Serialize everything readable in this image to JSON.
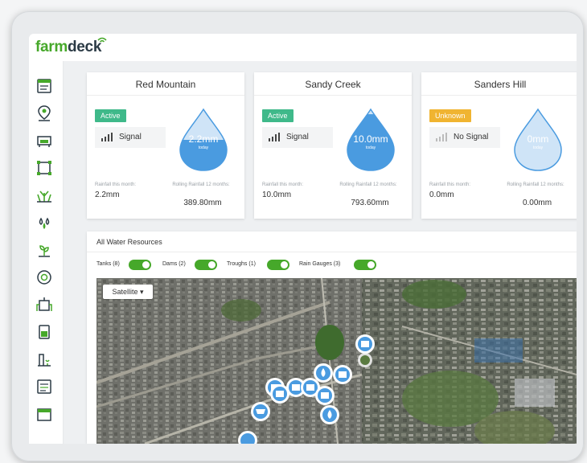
{
  "app": {
    "logo_part1": "farm",
    "logo_part2": "deck"
  },
  "sidebar": {
    "icons": [
      "dashboard-icon",
      "location-pin-icon",
      "livestock-icon",
      "paddock-map-icon",
      "crops-icon",
      "water-drops-icon",
      "seedling-icon",
      "gauge-icon",
      "pump-icon",
      "tank-icon",
      "irrigation-icon",
      "reports-icon",
      "calendar-icon"
    ]
  },
  "stations": [
    {
      "name": "Red Mountain",
      "status": "Active",
      "signal": "Signal",
      "amount": "2.2mm",
      "today": "today",
      "fill": 0.5,
      "month_label": "Rainfall this month:",
      "month_value": "2.2mm",
      "rolling_label": "Rolling Rainfall 12 months:",
      "rolling_value": "389.80mm"
    },
    {
      "name": "Sandy Creek",
      "status": "Active",
      "signal": "Signal",
      "amount": "10.0mm",
      "today": "today",
      "fill": 0.92,
      "month_label": "Rainfall this month:",
      "month_value": "10.0mm",
      "rolling_label": "Rolling Rainfall 12 months:",
      "rolling_value": "793.60mm"
    },
    {
      "name": "Sanders Hill",
      "status": "Unknown",
      "signal": "No Signal",
      "amount": "0mm",
      "today": "today",
      "fill": 0.0,
      "month_label": "Rainfall this month:",
      "month_value": "0.0mm",
      "rolling_label": "Rolling Rainfall 12 months:",
      "rolling_value": "0.00mm"
    }
  ],
  "resources": {
    "title": "All Water Resources",
    "toggles": [
      {
        "label": "Tanks (8)",
        "on": true
      },
      {
        "label": "Dams (2)",
        "on": true
      },
      {
        "label": "Troughs (1)",
        "on": true
      },
      {
        "label": "Rain Gauges (3)",
        "on": true
      }
    ],
    "map_type": "Satellite"
  },
  "colors": {
    "brand_green": "#46a82a",
    "active": "#3fb98a",
    "unknown": "#f0b431",
    "drop_blue": "#4a9be0"
  }
}
